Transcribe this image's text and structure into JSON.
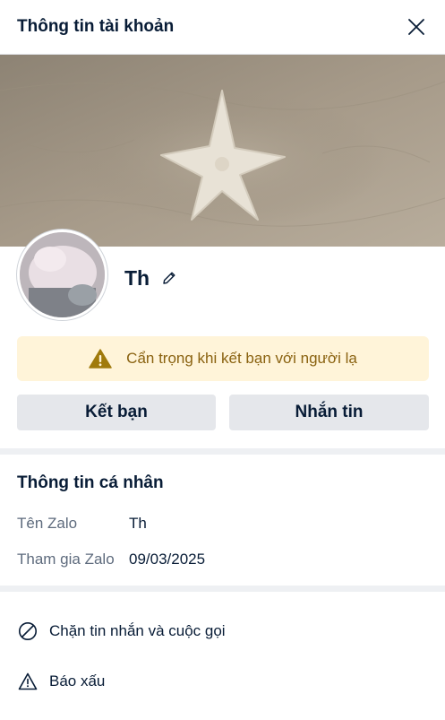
{
  "header": {
    "title": "Thông tin tài khoản"
  },
  "profile": {
    "name": "Th"
  },
  "warning": {
    "text": "Cẩn trọng khi kết bạn với người lạ"
  },
  "buttons": {
    "add_friend": "Kết bạn",
    "message": "Nhắn tin"
  },
  "personal_info": {
    "title": "Thông tin cá nhân",
    "rows": [
      {
        "label": "Tên Zalo",
        "value": "Th"
      },
      {
        "label": "Tham gia Zalo",
        "value": "09/03/2025"
      }
    ]
  },
  "actions": [
    {
      "label": "Chặn tin nhắn và cuộc gọi",
      "icon": "block-icon"
    },
    {
      "label": "Báo xấu",
      "icon": "warning-outline-icon"
    }
  ],
  "colors": {
    "text_primary": "#081c36",
    "text_secondary": "#5e6b7d",
    "warning_bg": "#fff4d9",
    "warning_icon": "#a07a0c",
    "button_bg": "#e5e7eb",
    "divider": "#eef0f3"
  }
}
